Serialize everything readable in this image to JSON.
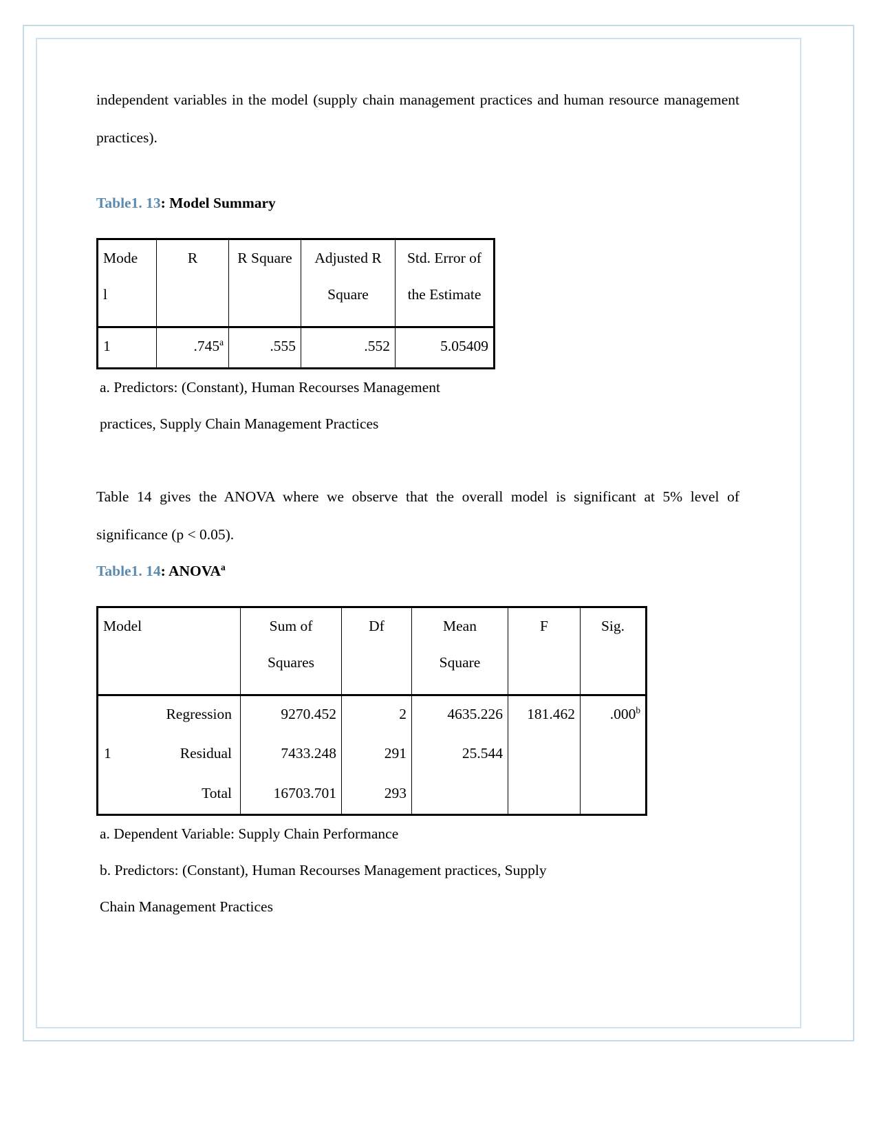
{
  "document": {
    "paragraph_intro": "independent variables in the model (supply chain management practices and human resource management practices).",
    "paragraph_anova": "Table 14 gives the ANOVA where we observe that the overall model is significant at 5% level of significance (p < 0.05)."
  },
  "accent_color": "#5b8bb0",
  "model_summary": {
    "caption_number": "Table1. 13",
    "caption_rest": ": Model Summary",
    "headers": [
      "Model",
      "R",
      "R Square",
      "Adjusted R Square",
      "Std. Error of the Estimate"
    ],
    "header_model_line1": "Mode",
    "header_model_line2": "l",
    "header_r": "R",
    "header_rsquare": "R Square",
    "header_adjr_line1": "Adjusted R",
    "header_adjr_line2": "Square",
    "header_stderr_line1": "Std. Error of",
    "header_stderr_line2": "the Estimate",
    "rows": [
      {
        "model": "1",
        "r": ".745",
        "r_superscript": "a",
        "r_square": ".555",
        "adjusted_r_square": ".552",
        "std_error": "5.05409"
      }
    ],
    "footnotes": [
      "a. Predictors: (Constant), Human Recourses Management",
      "practices, Supply Chain Management Practices"
    ]
  },
  "anova": {
    "caption_number": "Table1. 14",
    "caption_rest": ": ANOVA",
    "caption_superscript": "a",
    "header_model": "Model",
    "header_sum_line1": "Sum of",
    "header_sum_line2": "Squares",
    "header_df": "Df",
    "header_mean_line1": "Mean",
    "header_mean_line2": "Square",
    "header_f": "F",
    "header_sig": "Sig.",
    "model_number": "1",
    "rows": [
      {
        "source": "Regression",
        "sum_of_squares": "9270.452",
        "df": "2",
        "mean_square": "4635.226",
        "f": "181.462",
        "sig": ".000",
        "sig_superscript": "b"
      },
      {
        "source": "Residual",
        "sum_of_squares": "7433.248",
        "df": "291",
        "mean_square": "25.544",
        "f": "",
        "sig": "",
        "sig_superscript": ""
      },
      {
        "source": "Total",
        "sum_of_squares": "16703.701",
        "df": "293",
        "mean_square": "",
        "f": "",
        "sig": "",
        "sig_superscript": ""
      }
    ],
    "footnotes": [
      "a. Dependent Variable: Supply Chain Performance",
      "b. Predictors: (Constant), Human Recourses Management practices, Supply",
      "Chain Management Practices"
    ]
  }
}
